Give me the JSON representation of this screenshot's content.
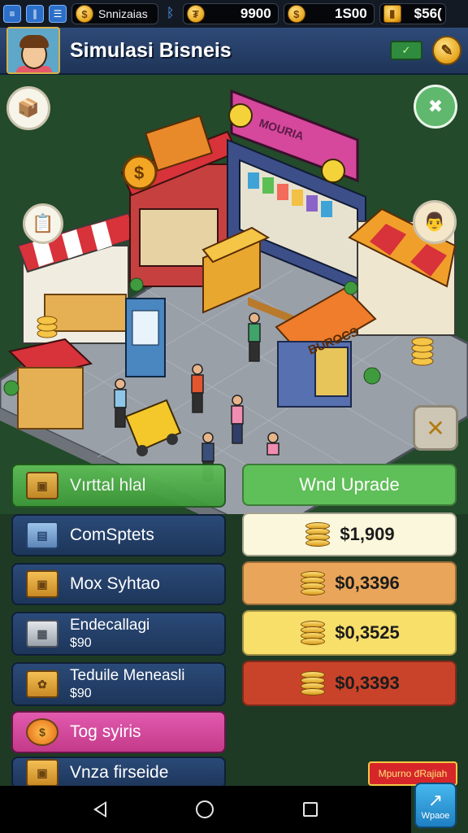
{
  "status_bar": {
    "game_name": "Snnizaias",
    "currency_1": "9900",
    "currency_2": "1S00",
    "currency_3": "$56("
  },
  "header": {
    "title": "Simulasi Bisneis"
  },
  "scene": {
    "shop_signs": [
      "MOURIA",
      "BUROCS"
    ],
    "menu_items_left": [
      {
        "label": "Vırttal hlal"
      },
      {
        "label": "ComSptets"
      },
      {
        "label": "Mox Syhtao"
      },
      {
        "label": "Endecallagi",
        "sub": "$90"
      },
      {
        "label": "Teduile Meneasli",
        "sub": "$90"
      },
      {
        "label": "Tog syiris"
      },
      {
        "label": "Vnza firseide"
      }
    ],
    "menu_items_right": [
      {
        "label": "Wnd Uprade",
        "color": "#5fbf58"
      },
      {
        "label": "$1,909",
        "color": "#fbf7dc"
      },
      {
        "label": "$0,3396",
        "color": "#e9a55a"
      },
      {
        "label": "$0,3525",
        "color": "#f7df6a"
      },
      {
        "label": "$0,3393",
        "color": "#c8432a"
      }
    ]
  },
  "badges": {
    "upgrade_label": "Mpurno đRajiah",
    "upload_label": "Wpaoe"
  },
  "colors": {
    "accent_gold": "#e7a51c",
    "panel_blue": "#1f3558",
    "highlight_green": "#5fbf58",
    "highlight_pink": "#d948a0"
  }
}
